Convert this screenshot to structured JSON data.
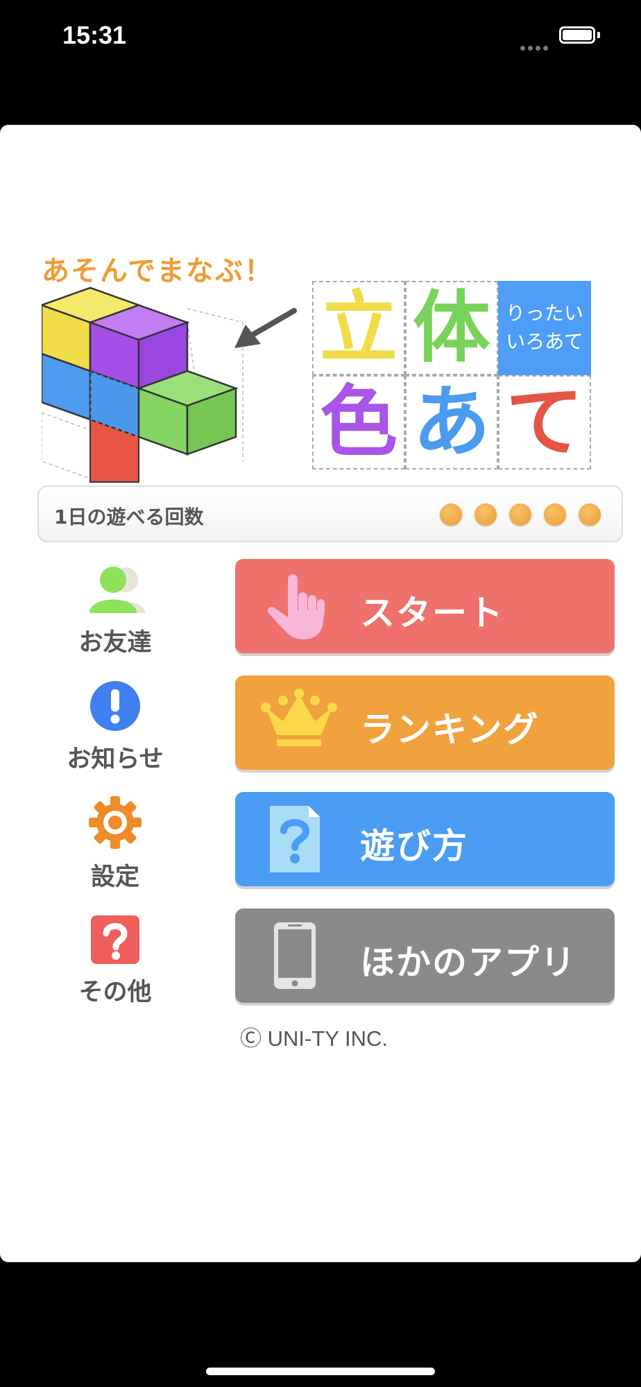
{
  "status_bar": {
    "time": "15:31"
  },
  "app": {
    "tagline": "あそんでまなぶ！",
    "title": {
      "chars": [
        "立",
        "体",
        "色",
        "あ",
        "て"
      ],
      "reading_line1": "りったい",
      "reading_line2": "いろあて"
    },
    "plays": {
      "label": "1日の遊べる回数",
      "remaining": 5,
      "dot_color": "#f0a33a"
    },
    "side_menu": [
      {
        "label": "お友達",
        "icon": "friends-icon"
      },
      {
        "label": "お知らせ",
        "icon": "info-icon"
      },
      {
        "label": "設定",
        "icon": "gear-icon"
      },
      {
        "label": "その他",
        "icon": "question-icon"
      }
    ],
    "buttons": [
      {
        "label": "スタート",
        "icon": "hand-pointer-icon",
        "color": "#ee716c"
      },
      {
        "label": "ランキング",
        "icon": "crown-icon",
        "color": "#f0a23e"
      },
      {
        "label": "遊び方",
        "icon": "help-document-icon",
        "color": "#4b9cf3"
      },
      {
        "label": "ほかのアプリ",
        "icon": "smartphone-icon",
        "color": "#8a8a8a"
      }
    ],
    "copyright": "Ⓒ UNI-TY INC."
  }
}
